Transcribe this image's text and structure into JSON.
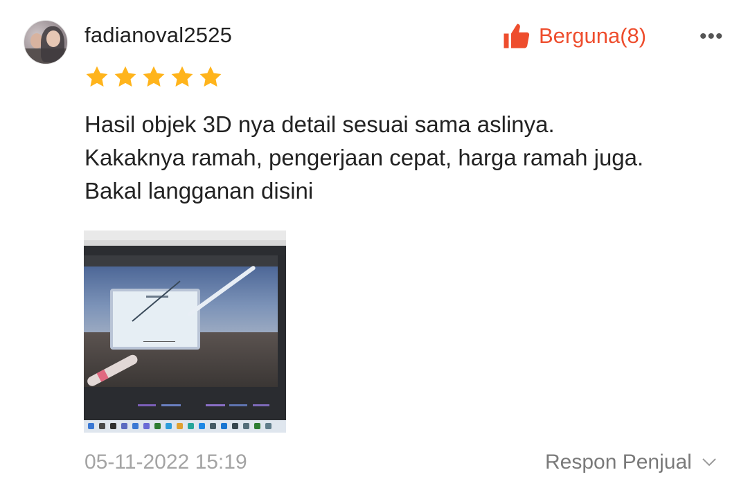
{
  "review": {
    "username": "fadianoval2525",
    "helpful_label": "Berguna(8)",
    "more_label": "•••",
    "rating": 5,
    "rating_max": 5,
    "text_lines": [
      "Hasil objek 3D nya detail sesuai sama aslinya.",
      "Kakaknya ramah, pengerjaan cepat, harga ramah juga.",
      "Bakal langganan disini"
    ],
    "timestamp": "05-11-2022 15:19",
    "seller_response_label": "Respon Penjual"
  },
  "colors": {
    "accent": "#ee4d2d",
    "star": "#ffb41c",
    "muted": "#a4a4a4"
  },
  "icons": {
    "helpful": "thumbs-up-icon",
    "more": "more-dots-icon",
    "star": "star-icon",
    "expand": "chevron-down-icon"
  }
}
